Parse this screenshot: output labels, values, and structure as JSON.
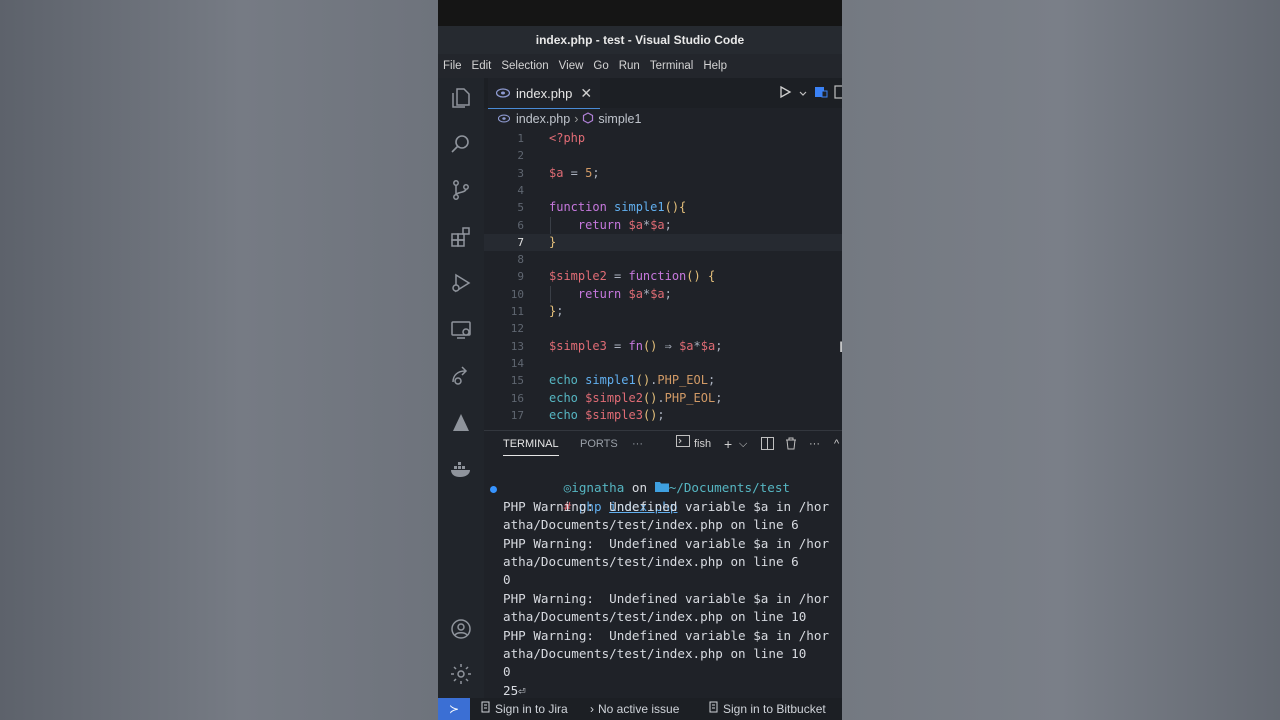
{
  "window": {
    "title": "index.php - test - Visual Studio Code"
  },
  "menu": [
    "File",
    "Edit",
    "Selection",
    "View",
    "Go",
    "Run",
    "Terminal",
    "Help"
  ],
  "activity_icons": [
    "explorer-icon",
    "search-icon",
    "source-control-icon",
    "extensions-icon",
    "run-debug-icon",
    "remote-explorer-icon",
    "live-share-icon",
    "atlassian-icon",
    "docker-icon",
    "account-icon",
    "settings-gear-icon"
  ],
  "editor": {
    "tab_label": "index.php",
    "tab_close": "✕",
    "breadcrumb": {
      "file": "index.php",
      "sep": "›",
      "symbol": "simple1"
    },
    "current_line": 7
  },
  "code_lines": [
    {
      "n": "1",
      "tokens": [
        [
          "t-tag",
          "<?php"
        ]
      ]
    },
    {
      "n": "2",
      "tokens": []
    },
    {
      "n": "3",
      "tokens": [
        [
          "t-var",
          "$a"
        ],
        [
          "t-punc",
          " = "
        ],
        [
          "t-num",
          "5"
        ],
        [
          "t-punc",
          ";"
        ]
      ]
    },
    {
      "n": "4",
      "tokens": []
    },
    {
      "n": "5",
      "tokens": [
        [
          "t-kw",
          "function"
        ],
        [
          "t-punc",
          " "
        ],
        [
          "t-fn",
          "simple1"
        ],
        [
          "t-br",
          "(){"
        ]
      ]
    },
    {
      "n": "6",
      "tokens": [
        [
          "t-punc",
          "    "
        ],
        [
          "t-kw",
          "return"
        ],
        [
          "t-punc",
          " "
        ],
        [
          "t-var",
          "$a"
        ],
        [
          "t-punc",
          "*"
        ],
        [
          "t-var",
          "$a"
        ],
        [
          "t-punc",
          ";"
        ]
      ]
    },
    {
      "n": "7",
      "tokens": [
        [
          "t-br",
          "}"
        ]
      ]
    },
    {
      "n": "8",
      "tokens": []
    },
    {
      "n": "9",
      "tokens": [
        [
          "t-var",
          "$simple2"
        ],
        [
          "t-punc",
          " = "
        ],
        [
          "t-kw",
          "function"
        ],
        [
          "t-br",
          "()"
        ],
        [
          "t-punc",
          " "
        ],
        [
          "t-br",
          "{"
        ]
      ]
    },
    {
      "n": "10",
      "tokens": [
        [
          "t-punc",
          "    "
        ],
        [
          "t-kw",
          "return"
        ],
        [
          "t-punc",
          " "
        ],
        [
          "t-var",
          "$a"
        ],
        [
          "t-punc",
          "*"
        ],
        [
          "t-var",
          "$a"
        ],
        [
          "t-punc",
          ";"
        ]
      ]
    },
    {
      "n": "11",
      "tokens": [
        [
          "t-br",
          "}"
        ],
        [
          "t-punc",
          ";"
        ]
      ]
    },
    {
      "n": "12",
      "tokens": []
    },
    {
      "n": "13",
      "tokens": [
        [
          "t-var",
          "$simple3"
        ],
        [
          "t-punc",
          " = "
        ],
        [
          "t-kw",
          "fn"
        ],
        [
          "t-br",
          "()"
        ],
        [
          "t-punc",
          " ⇒ "
        ],
        [
          "t-var",
          "$a"
        ],
        [
          "t-punc",
          "*"
        ],
        [
          "t-var",
          "$a"
        ],
        [
          "t-punc",
          ";"
        ]
      ]
    },
    {
      "n": "14",
      "tokens": []
    },
    {
      "n": "15",
      "tokens": [
        [
          "t-echo",
          "echo"
        ],
        [
          "t-punc",
          " "
        ],
        [
          "t-fn",
          "simple1"
        ],
        [
          "t-br",
          "()"
        ],
        [
          "t-punc",
          "."
        ],
        [
          "t-const",
          "PHP_EOL"
        ],
        [
          "t-punc",
          ";"
        ]
      ]
    },
    {
      "n": "16",
      "tokens": [
        [
          "t-echo",
          "echo"
        ],
        [
          "t-punc",
          " "
        ],
        [
          "t-var",
          "$simple2"
        ],
        [
          "t-br",
          "()"
        ],
        [
          "t-punc",
          "."
        ],
        [
          "t-const",
          "PHP_EOL"
        ],
        [
          "t-punc",
          ";"
        ]
      ]
    },
    {
      "n": "17",
      "tokens": [
        [
          "t-echo",
          "echo"
        ],
        [
          "t-punc",
          " "
        ],
        [
          "t-var",
          "$simple3"
        ],
        [
          "t-br",
          "()"
        ],
        [
          "t-punc",
          ";"
        ]
      ]
    }
  ],
  "panel": {
    "tabs": [
      "TERMINAL",
      "PORTS",
      "···"
    ],
    "shell": "fish",
    "controls": [
      "+",
      "⌵",
      "split",
      "trash",
      "···",
      "^"
    ]
  },
  "terminal": {
    "prompt_user": "ignatha",
    "prompt_on": " on ",
    "prompt_path": "~/Documents/test",
    "command_hash": "# ",
    "command_php": "php ",
    "command_file": "index.php",
    "output": [
      "PHP Warning:  Undefined variable $a in /hor",
      "atha/Documents/test/index.php on line 6",
      "PHP Warning:  Undefined variable $a in /hor",
      "atha/Documents/test/index.php on line 6",
      "0",
      "PHP Warning:  Undefined variable $a in /hor",
      "atha/Documents/test/index.php on line 10",
      "PHP Warning:  Undefined variable $a in /hor",
      "atha/Documents/test/index.php on line 10",
      "0",
      "25⏎"
    ]
  },
  "statusbar": {
    "remote": "≻",
    "jira": "Sign in to Jira",
    "issue": "No active issue",
    "bitbucket": "Sign in to Bitbucket"
  },
  "colors": {
    "accent": "#3b6fd4",
    "tab_indicator": "#4a8bd6",
    "prompt_cyan": "#56b6c2",
    "link_blue": "#61afef"
  }
}
